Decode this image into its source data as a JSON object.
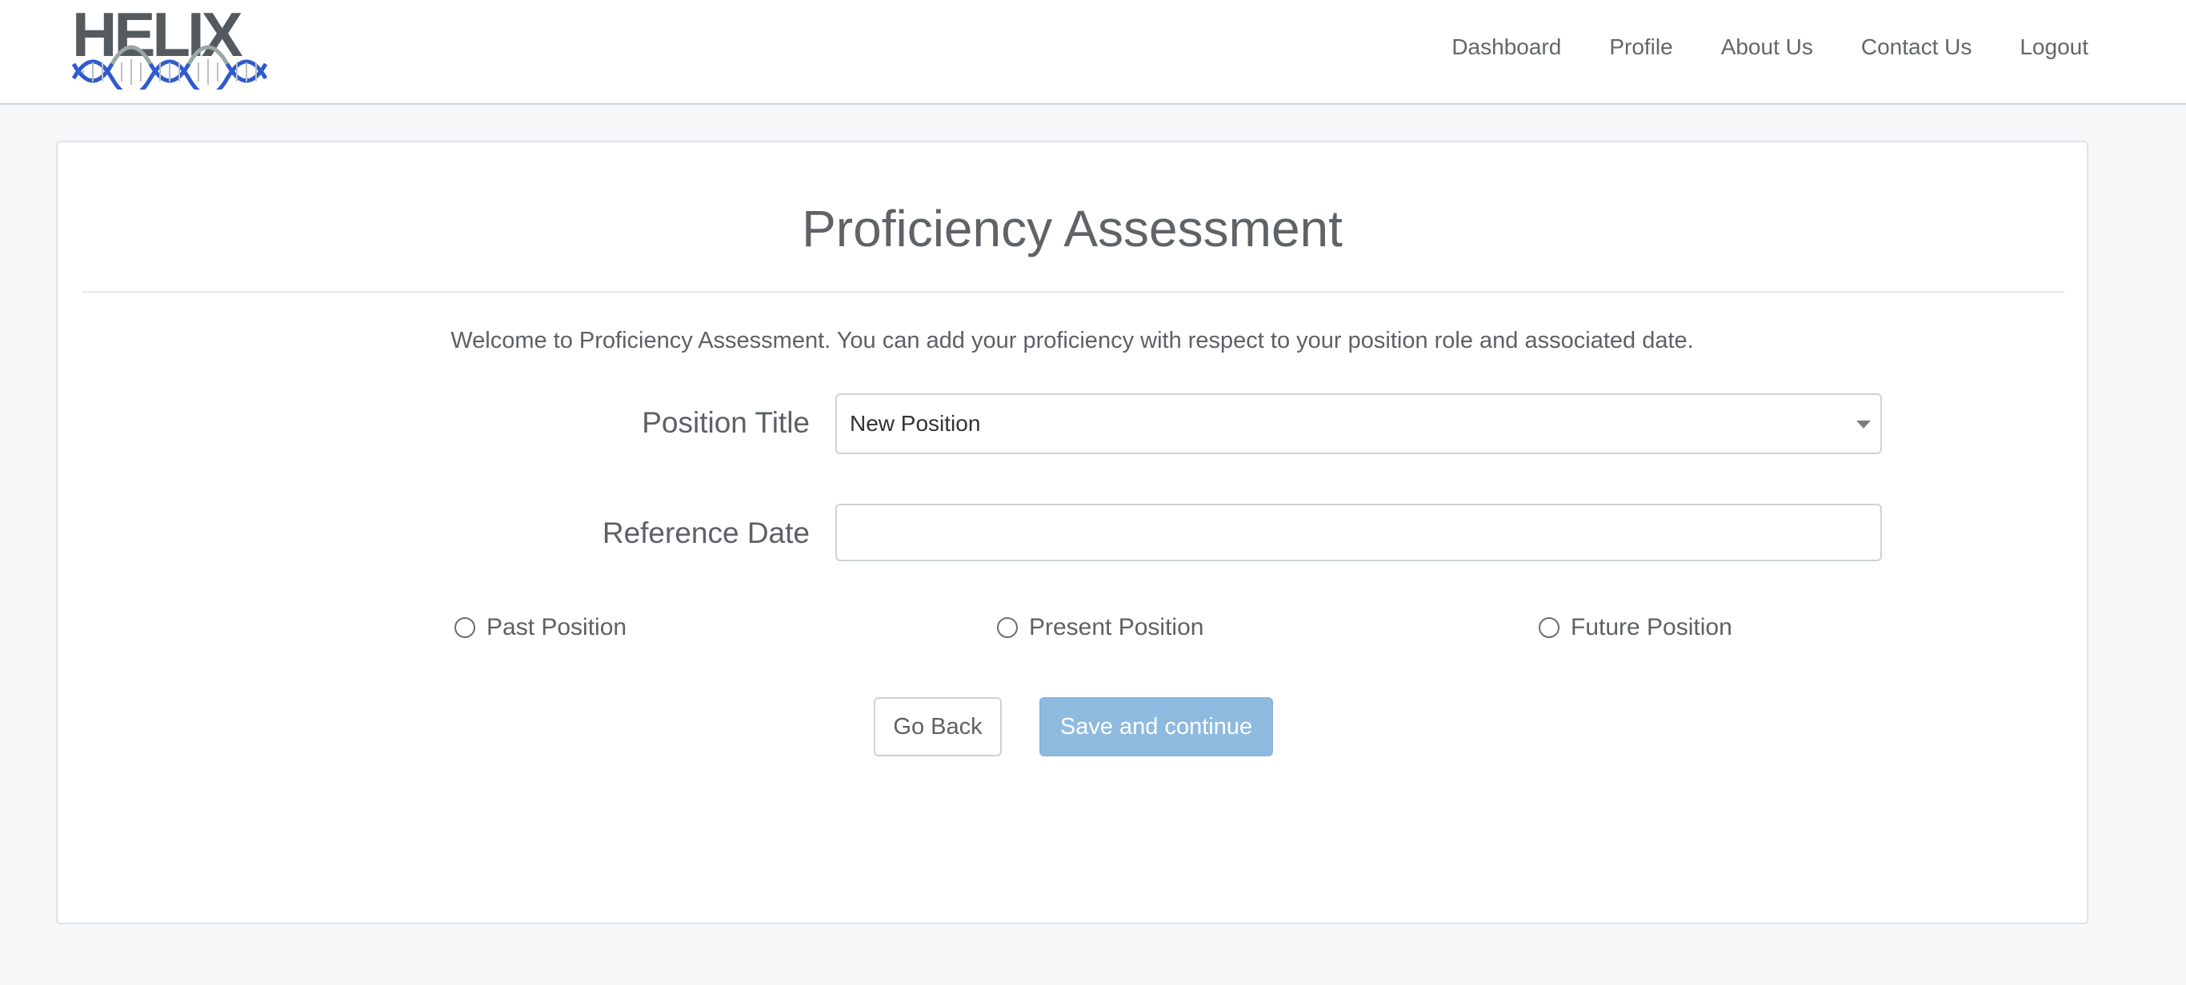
{
  "brand": {
    "logo_text": "HELIX"
  },
  "nav": {
    "items": [
      {
        "label": "Dashboard"
      },
      {
        "label": "Profile"
      },
      {
        "label": "About Us"
      },
      {
        "label": "Contact Us"
      },
      {
        "label": "Logout"
      }
    ]
  },
  "page": {
    "title": "Proficiency Assessment",
    "intro": "Welcome to Proficiency Assessment. You can add your proficiency with respect to your position role and associated date."
  },
  "form": {
    "position_title": {
      "label": "Position Title",
      "selected": "New Position"
    },
    "reference_date": {
      "label": "Reference Date",
      "value": ""
    },
    "position_timing": {
      "options": [
        {
          "label": "Past Position",
          "checked": false
        },
        {
          "label": "Present Position",
          "checked": false
        },
        {
          "label": "Future Position",
          "checked": false
        }
      ]
    }
  },
  "actions": {
    "back_label": "Go Back",
    "save_label": "Save and continue"
  },
  "colors": {
    "primary_button": "#8fbadf",
    "logo_dark": "#555a5e",
    "helix_blue": "#2f5bd0",
    "helix_grey": "#9aa8a4"
  }
}
